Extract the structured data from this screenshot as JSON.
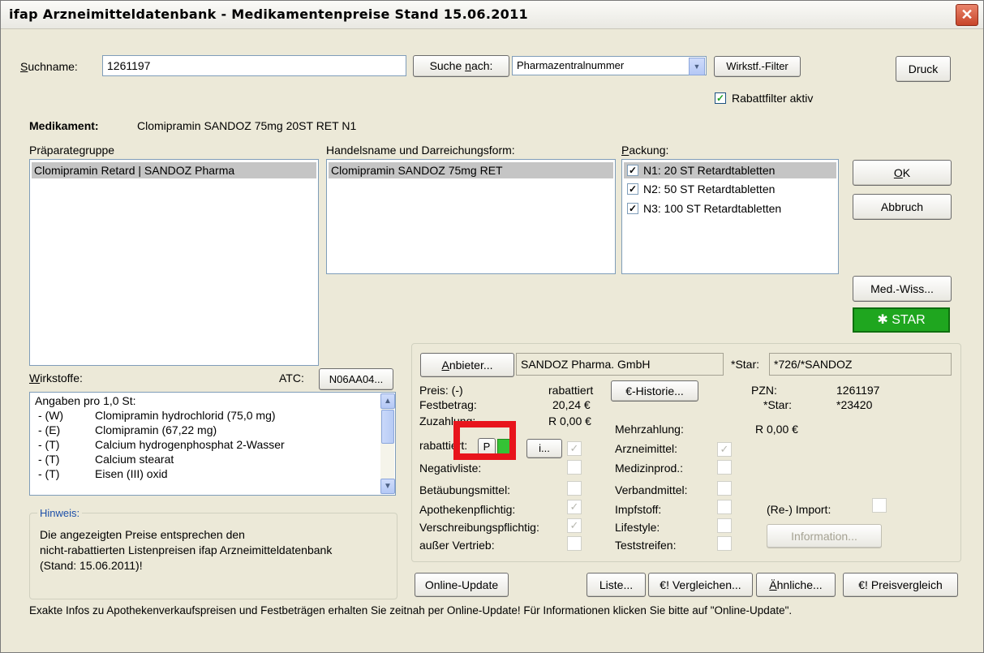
{
  "window": {
    "title": "ifap Arzneimitteldatenbank  -  Medikamentenpreise Stand 15.06.2011",
    "close_icon": "close-icon"
  },
  "search": {
    "label": "Suchname:",
    "value": "1261197",
    "search_by_button": "Suche nach:",
    "search_type": "Pharmazentralnummer",
    "wirkstoff_filter_button": "Wirkstf.-Filter",
    "print_button": "Druck",
    "rebate_filter_label": "Rabattfilter aktiv",
    "rebate_filter_checked": true
  },
  "medication": {
    "label": "Medikament:",
    "value": "Clomipramin SANDOZ 75mg 20ST RET N1"
  },
  "lists": {
    "group_label": "Präparategruppe",
    "group_items": [
      "Clomipramin Retard | SANDOZ Pharma"
    ],
    "tradename_label": "Handelsname und Darreichungsform:",
    "tradename_items": [
      "Clomipramin SANDOZ 75mg RET"
    ],
    "package_label": "Packung:",
    "package_items": [
      "N1: 20 ST Retardtabletten",
      "N2: 50 ST Retardtabletten",
      "N3: 100 ST Retardtabletten"
    ]
  },
  "buttons": {
    "ok": "OK",
    "cancel": "Abbruch",
    "med_wiss": "Med.-Wiss...",
    "star": "STAR",
    "anbieter": "Anbieter...",
    "historie": "€-Historie...",
    "info_small": "i...",
    "p_button": "P",
    "online_update": "Online-Update",
    "liste": "Liste...",
    "vergleichen": "€! Vergleichen...",
    "aehnliche": "Ähnliche...",
    "preisvergleich": "€! Preisvergleich",
    "information": "Information..."
  },
  "ingredients": {
    "label": "Wirkstoffe:",
    "atc_label": "ATC:",
    "atc_value": "N06AA04...",
    "header": "Angaben pro 1,0 St:",
    "items": [
      {
        "code": "- (W)",
        "name": "Clomipramin hydrochlorid (75,0 mg)"
      },
      {
        "code": "- (E)",
        "name": "Clomipramin (67,22 mg)"
      },
      {
        "code": "- (T)",
        "name": "Calcium hydrogenphosphat 2-Wasser"
      },
      {
        "code": "- (T)",
        "name": "Calcium stearat"
      },
      {
        "code": "- (T)",
        "name": "Eisen (III) oxid"
      }
    ]
  },
  "hint": {
    "label": "Hinweis:",
    "text_lines": [
      "Die angezeigten Preise entsprechen den",
      "nicht-rabattierten Listenpreisen ifap Arzneimitteldatenbank",
      "(Stand: 15.06.2011)!"
    ]
  },
  "details": {
    "anbieter_value": "SANDOZ Pharma. GmbH",
    "star_label": "*Star:",
    "star_value": "*726/*SANDOZ",
    "preis_label": "Preis:  (-)",
    "rabattiert_label": "rabattiert",
    "festbetrag_label": "Festbetrag:",
    "festbetrag_value": "20,24 €",
    "zuzahlung_label": "Zuzahlung:",
    "zuzahlung_value": "R 0,00 €",
    "rabattiert_row_label": "rabattiert:",
    "negativliste_label": "Negativliste:",
    "btm_label": "Betäubungsmittel:",
    "apo_label": "Apothekenpflichtig:",
    "rezept_label": "Verschreibungspflichtig:",
    "ausser_label": "außer Vertrieb:",
    "pzn_label": "PZN:",
    "pzn_value": "1261197",
    "star2_label": "*Star:",
    "star2_value": "*23420",
    "mehrzahlung_label": "Mehrzahlung:",
    "mehrzahlung_value": "R 0,00 €",
    "arznei_label": "Arzneimittel:",
    "medprod_label": "Medizinprod.:",
    "verband_label": "Verbandmittel:",
    "impf_label": "Impfstoff:",
    "lifestyle_label": "Lifestyle:",
    "test_label": "Teststreifen:",
    "reimport_label": "(Re-) Import:"
  },
  "footer": {
    "text": "Exakte Infos zu Apothekenverkaufspreisen und Festbeträgen erhalten Sie zeitnah per Online-Update! Für Informationen klicken Sie bitte auf \"Online-Update\"."
  },
  "colors": {
    "star_green": "#22a822",
    "highlight_red": "#e8141c"
  }
}
